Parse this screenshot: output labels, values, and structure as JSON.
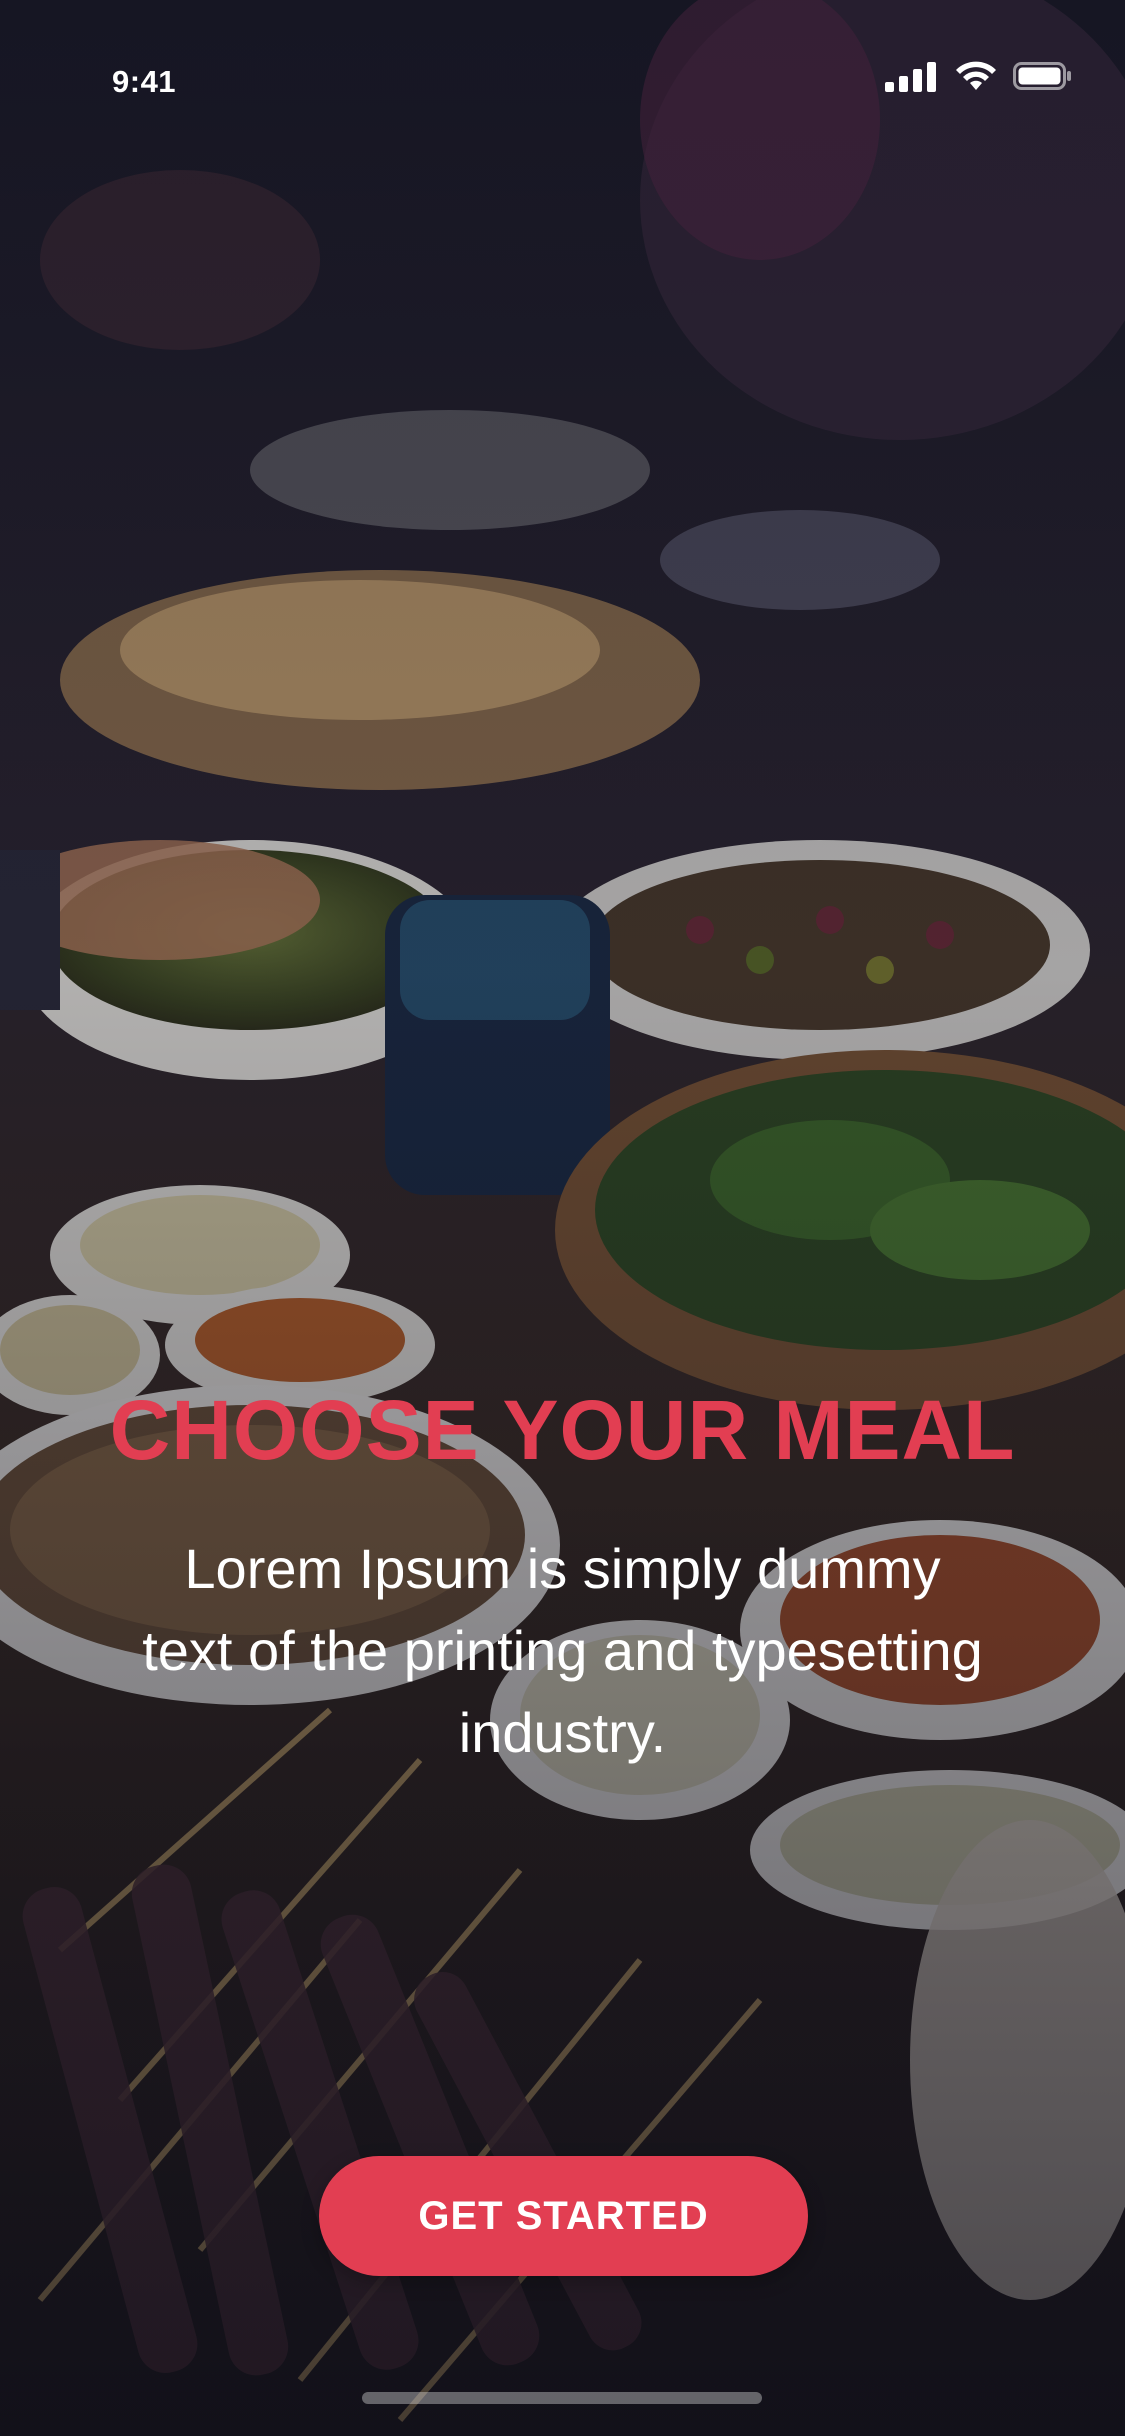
{
  "status_bar": {
    "time": "9:41",
    "signal_icon": "cellular-signal-icon",
    "wifi_icon": "wifi-icon",
    "battery_icon": "battery-icon"
  },
  "background": {
    "description_icon": "food-buffet-photo"
  },
  "onboarding": {
    "title": "CHOOSE YOUR MEAL",
    "body": "Lorem Ipsum is simply dummy text of the printing and typesetting industry.",
    "cta_label": "GET STARTED"
  },
  "colors": {
    "accent": "#e23e52",
    "text_light": "#ffffff",
    "background_dark": "#14141f"
  }
}
